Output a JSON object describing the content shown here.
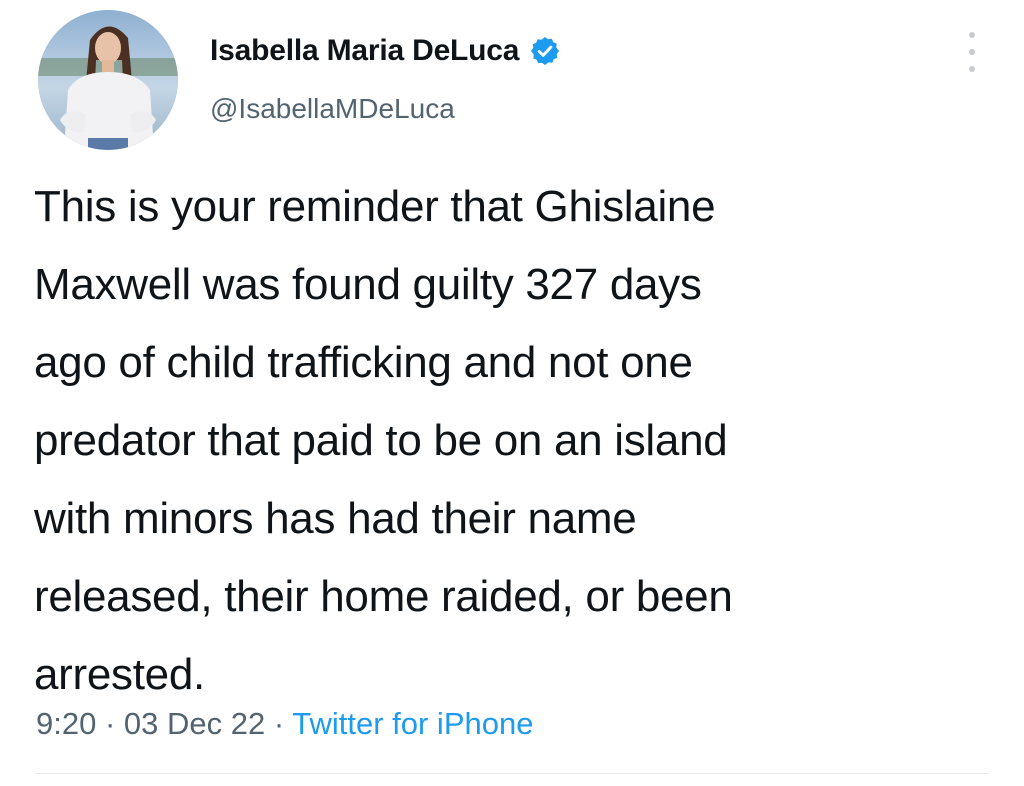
{
  "author": {
    "display_name": "Isabella Maria DeLuca",
    "handle": "@IsabellaMDeLuca",
    "verified": true
  },
  "tweet": {
    "text": "This is your reminder that Ghislaine\nMaxwell was found guilty 327 days\nago of child trafficking and not one\npredator that paid to be on an island\nwith minors has had their name\nreleased, their home raided, or been\narrested."
  },
  "meta": {
    "time": "9:20",
    "separator": " · ",
    "date": "03 Dec 22",
    "source": "Twitter for iPhone"
  },
  "colors": {
    "text": "#0f1419",
    "secondary": "#536471",
    "accent": "#1d9bf0"
  },
  "icons": {
    "verified": "verified-badge-icon",
    "more": "more-options-icon"
  }
}
